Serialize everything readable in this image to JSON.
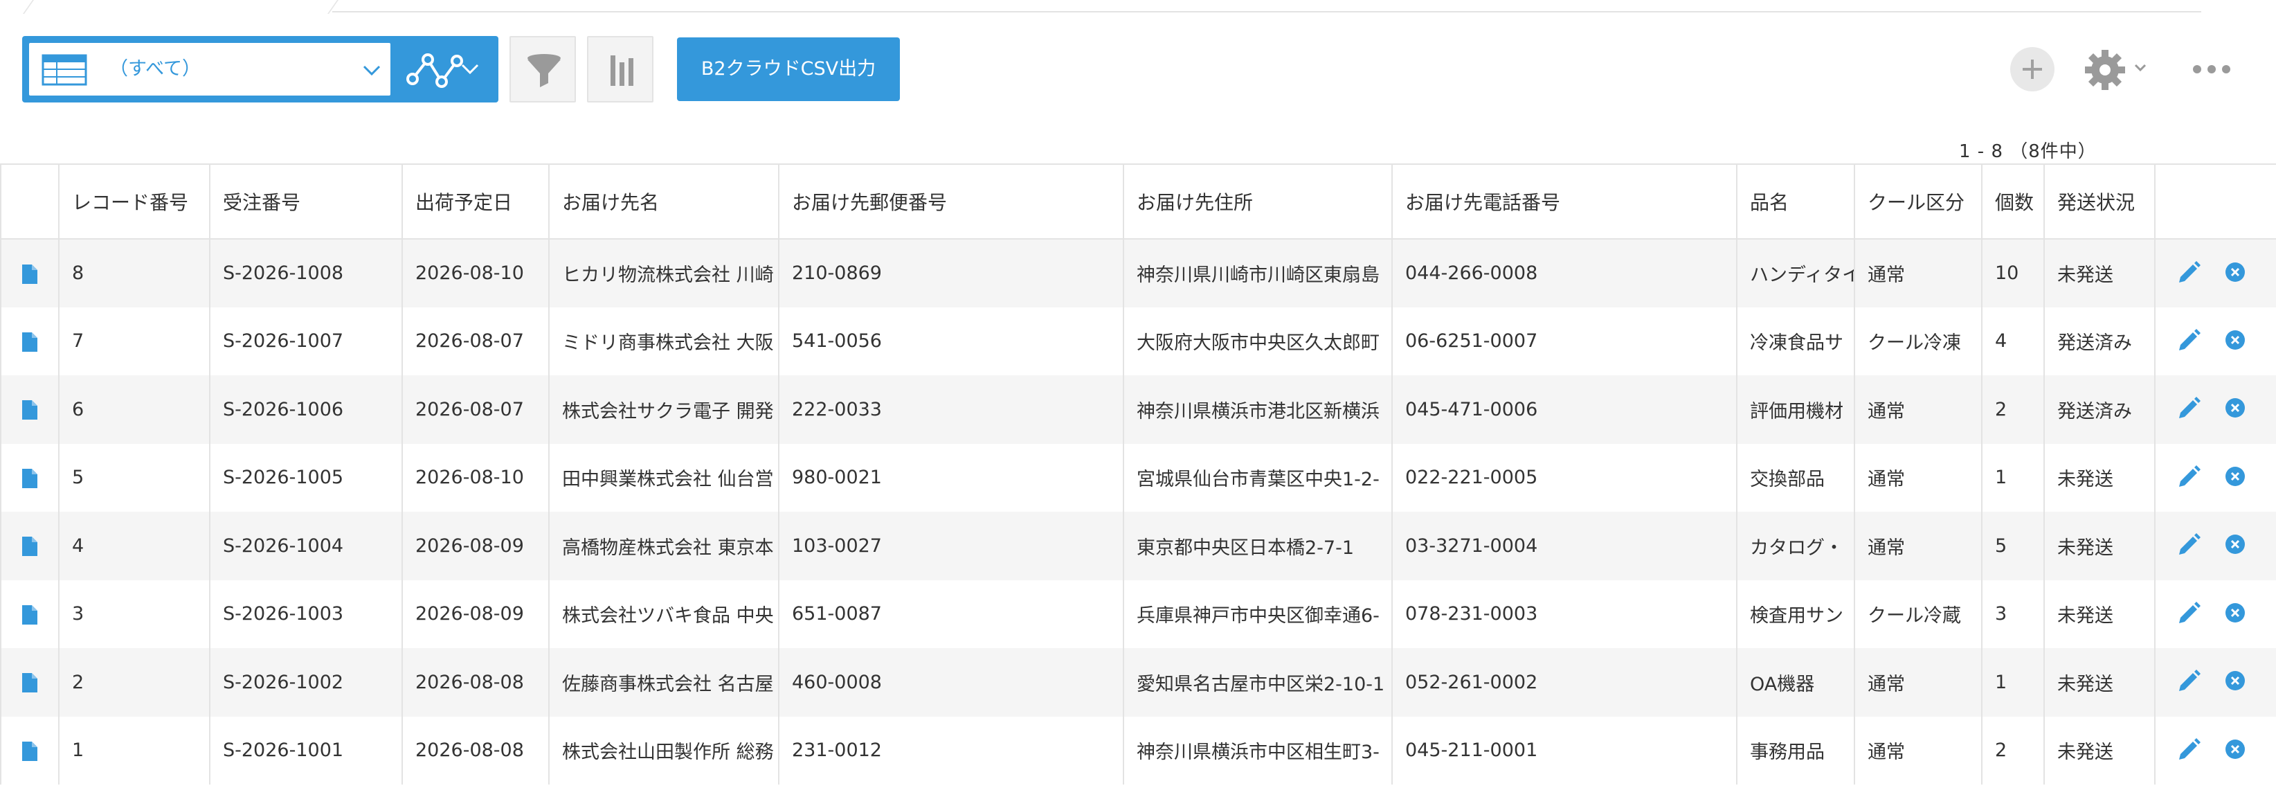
{
  "view": {
    "selected": "（すべて）"
  },
  "toolbar": {
    "csv_button_label": "B2クラウドCSV出力"
  },
  "pager": {
    "text": "1 - 8 （8件中）"
  },
  "colors": {
    "accent": "#3498db",
    "row_alt": "#f5f5f5",
    "border": "#e3e3e3"
  },
  "table": {
    "columns": [
      "レコード番号",
      "受注番号",
      "出荷予定日",
      "お届け先名",
      "お届け先郵便番号",
      "お届け先住所",
      "お届け先電話番号",
      "品名",
      "クール区分",
      "個数",
      "発送状況"
    ],
    "rows": [
      [
        "8",
        "S-2026-1008",
        "2026-08-10",
        "ヒカリ物流株式会社 川崎",
        "210-0869",
        "神奈川県川崎市川崎区東扇島",
        "044-266-0008",
        "ハンディタイ",
        "通常",
        "10",
        "未発送"
      ],
      [
        "7",
        "S-2026-1007",
        "2026-08-07",
        "ミドリ商事株式会社 大阪",
        "541-0056",
        "大阪府大阪市中央区久太郎町",
        "06-6251-0007",
        "冷凍食品サ",
        "クール冷凍",
        "4",
        "発送済み"
      ],
      [
        "6",
        "S-2026-1006",
        "2026-08-07",
        "株式会社サクラ電子 開発",
        "222-0033",
        "神奈川県横浜市港北区新横浜",
        "045-471-0006",
        "評価用機材",
        "通常",
        "2",
        "発送済み"
      ],
      [
        "5",
        "S-2026-1005",
        "2026-08-10",
        "田中興業株式会社 仙台営",
        "980-0021",
        "宮城県仙台市青葉区中央1-2-",
        "022-221-0005",
        "交換部品",
        "通常",
        "1",
        "未発送"
      ],
      [
        "4",
        "S-2026-1004",
        "2026-08-09",
        "高橋物産株式会社 東京本",
        "103-0027",
        "東京都中央区日本橋2-7-1",
        "03-3271-0004",
        "カタログ・",
        "通常",
        "5",
        "未発送"
      ],
      [
        "3",
        "S-2026-1003",
        "2026-08-09",
        "株式会社ツバキ食品 中央",
        "651-0087",
        "兵庫県神戸市中央区御幸通6-",
        "078-231-0003",
        "検査用サン",
        "クール冷蔵",
        "3",
        "未発送"
      ],
      [
        "2",
        "S-2026-1002",
        "2026-08-08",
        "佐藤商事株式会社 名古屋",
        "460-0008",
        "愛知県名古屋市中区栄2-10-1",
        "052-261-0002",
        "OA機器",
        "通常",
        "1",
        "未発送"
      ],
      [
        "1",
        "S-2026-1001",
        "2026-08-08",
        "株式会社山田製作所 総務",
        "231-0012",
        "神奈川県横浜市中区相生町3-",
        "045-211-0001",
        "事務用品",
        "通常",
        "2",
        "未発送"
      ]
    ]
  }
}
